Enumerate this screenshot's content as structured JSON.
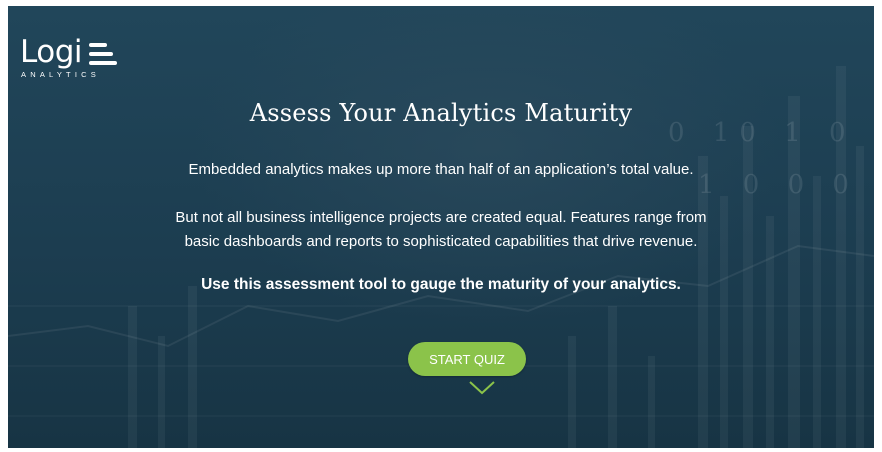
{
  "brand": {
    "logo_word": "Logi",
    "logo_sub": "ANALYTICS",
    "colors": {
      "accent": "#8bc34a",
      "background": "#1f4356",
      "text": "#ffffff"
    }
  },
  "hero": {
    "title": "Assess Your Analytics Maturity",
    "line1_a": "Embedded analytics makes up ",
    "line1_b": "more than half",
    "line1_c": " of an application’s total value.",
    "line2_a": "But not all business intelligence projects are created equal. Features range from",
    "line2_b": "basic dashboards and reports to sophisticated capabilities that drive revenue.",
    "line3": "Use this assessment tool to gauge the maturity of your analytics.",
    "cta_label": "START QUIZ"
  },
  "background_binary": {
    "row1": "0   10 1   0",
    "row2": "1  0 0   0"
  },
  "icons": {
    "logo": "logo-bars-icon",
    "scroll": "chevron-down-icon"
  }
}
